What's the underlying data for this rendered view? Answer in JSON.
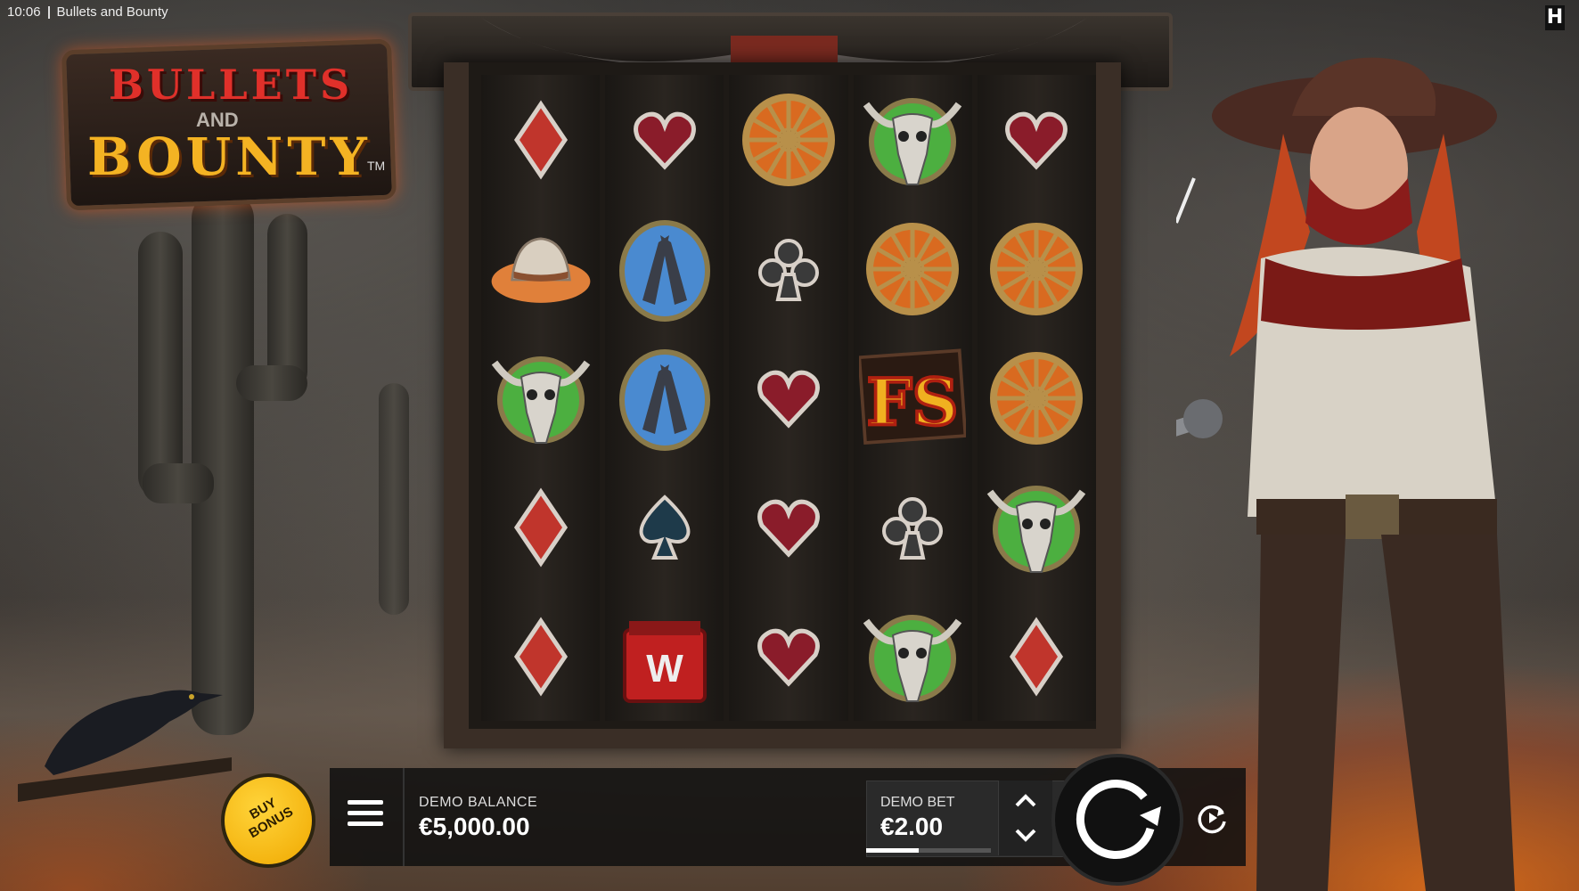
{
  "status_bar": {
    "time": "10:06",
    "app_title": "Bullets and Bounty"
  },
  "brand": {
    "icon": "hacksaw-logo-icon",
    "letter": "H"
  },
  "logo": {
    "line1": "BULLETS",
    "line2": "AND",
    "line3": "BOUNTY",
    "trademark": "TM"
  },
  "reels": [
    [
      "diamond",
      "cowboy-hat",
      "bull-skull",
      "diamond",
      "diamond"
    ],
    [
      "heart",
      "crossed-pistols",
      "crossed-pistols",
      "spade",
      "tnt-bomb"
    ],
    [
      "wagon-wheel",
      "club",
      "heart",
      "heart",
      "heart"
    ],
    [
      "bull-skull",
      "wagon-wheel",
      "fs-scatter",
      "club",
      "bull-skull"
    ],
    [
      "heart",
      "wagon-wheel",
      "wagon-wheel",
      "bull-skull",
      "diamond"
    ]
  ],
  "symbols": {
    "fs_text": "FS"
  },
  "controls": {
    "buy_bonus_label": "BUY BONUS",
    "balance_label": "DEMO BALANCE",
    "balance_value": "€5,000.00",
    "bet_label": "DEMO BET",
    "bet_value": "€2.00",
    "bet_level_fraction": 0.42
  },
  "colors": {
    "accent_yellow": "#f4b323",
    "logo_red": "#e0302a",
    "fire": "#ff7814"
  }
}
